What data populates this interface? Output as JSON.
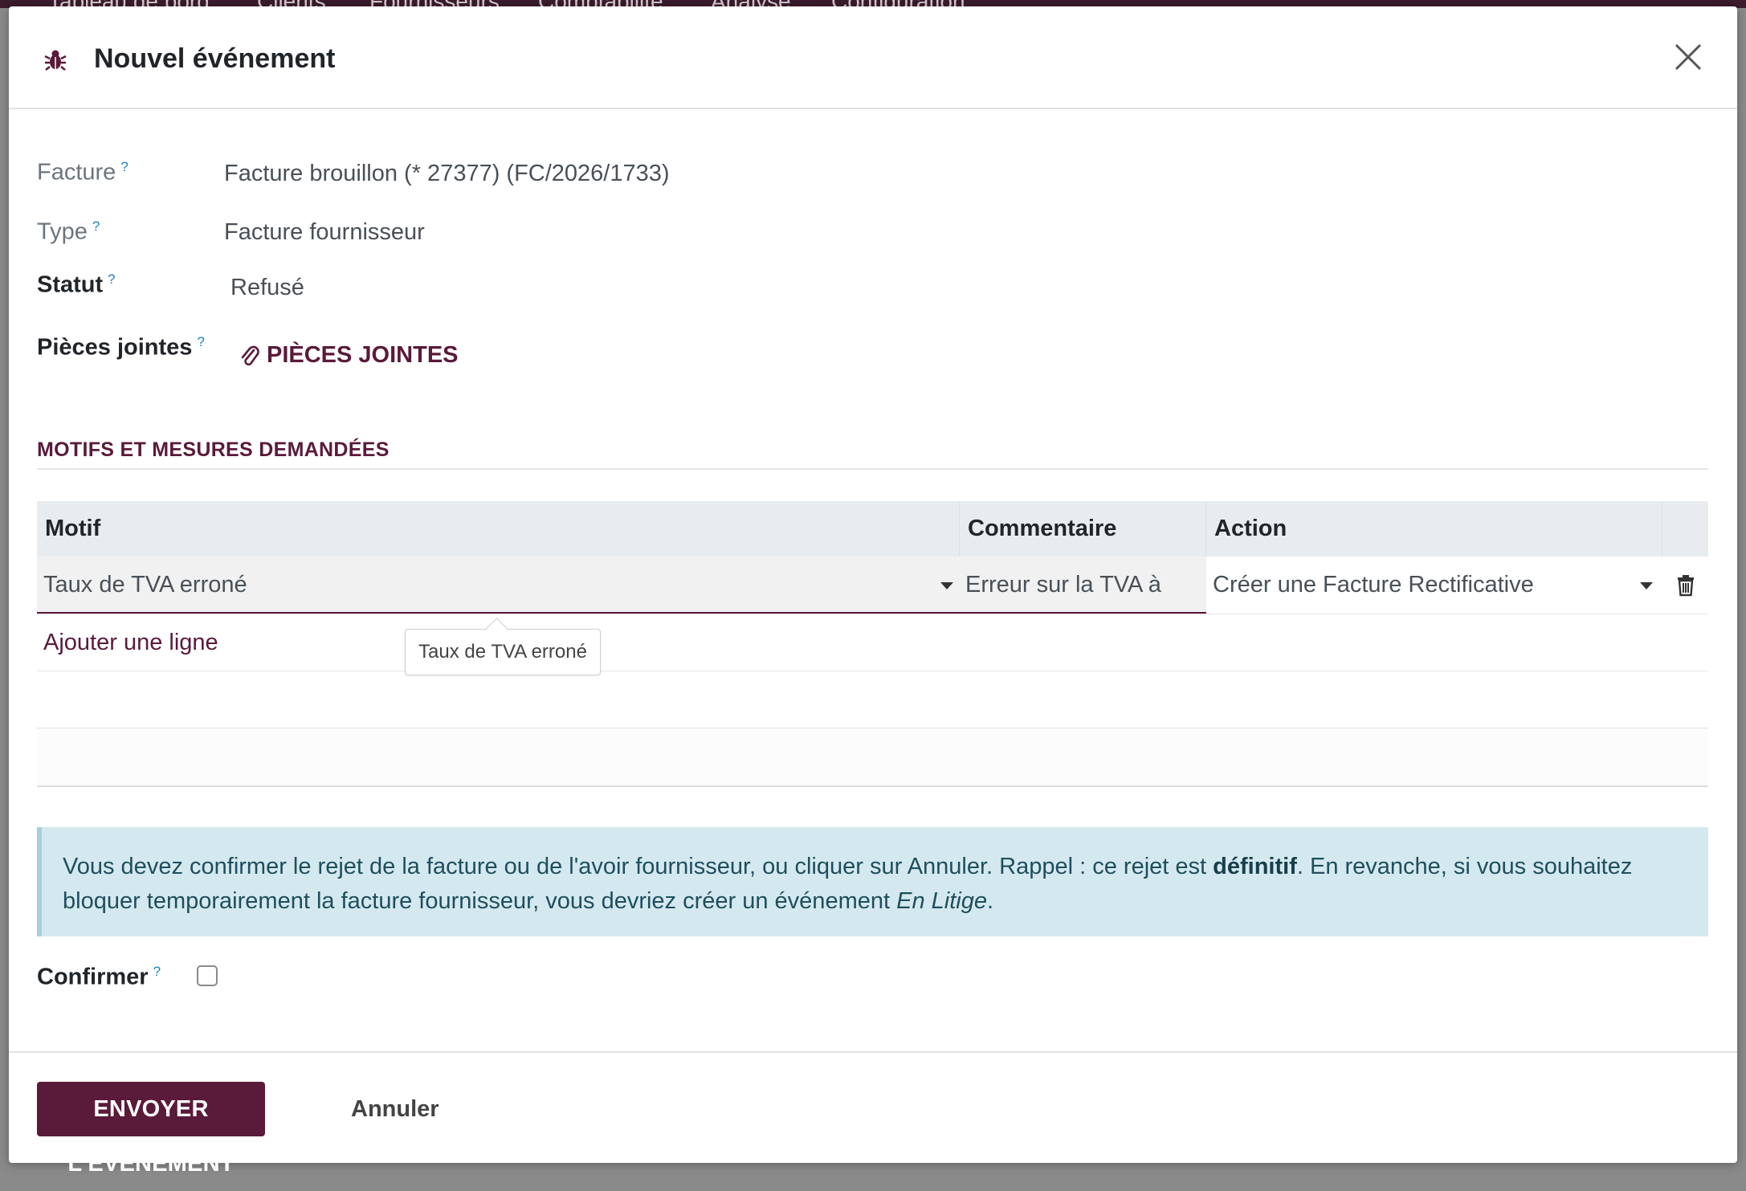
{
  "background": {
    "nav_items": [
      "Tableau de bord",
      "Clients",
      "Fournisseurs",
      "Comptabilité",
      "Analyse",
      "Configuration"
    ]
  },
  "dialog": {
    "title": "Nouvel événement",
    "header_icon": "bug-icon",
    "close_icon": "close-icon"
  },
  "fields": {
    "facture": {
      "label": "Facture",
      "help": "?",
      "value": "Facture brouillon (* 27377) (FC/2026/1733)"
    },
    "type": {
      "label": "Type",
      "help": "?",
      "value": "Facture fournisseur"
    },
    "statut": {
      "label": "Statut",
      "help": "?",
      "value": "Refusé"
    },
    "pieces": {
      "label": "Pièces jointes",
      "help": "?",
      "button_label": "PIÈCES JOINTES",
      "icon": "paperclip-icon"
    }
  },
  "section": {
    "title": "MOTIFS ET MESURES DEMANDÉES"
  },
  "table": {
    "columns": [
      "Motif",
      "Commentaire",
      "Action"
    ],
    "rows": [
      {
        "motif": "Taux de TVA erroné",
        "commentaire": "Erreur sur la TVA à",
        "action": "Créer une Facture Rectificative"
      }
    ],
    "add_line": "Ajouter une ligne",
    "tooltip": "Taux de TVA erroné"
  },
  "alert": {
    "part1": "Vous devez confirmer le rejet de la facture ou de l'avoir fournisseur, ou cliquer sur Annuler. Rappel : ce rejet est ",
    "bold": "définitif",
    "part2": ". En revanche, si vous souhaitez bloquer temporairement la facture fournisseur, vous devriez créer un événement ",
    "italic": "En Litige",
    "part3": "."
  },
  "confirm": {
    "label": "Confirmer",
    "help": "?",
    "checked": false
  },
  "footer": {
    "primary_label": "ENVOYER L'ÉVÉNEMENT",
    "cancel_label": "Annuler"
  },
  "colors": {
    "brand": "#5a1a3a",
    "alert_bg": "#d4e9ef",
    "help": "#1b84c5"
  }
}
